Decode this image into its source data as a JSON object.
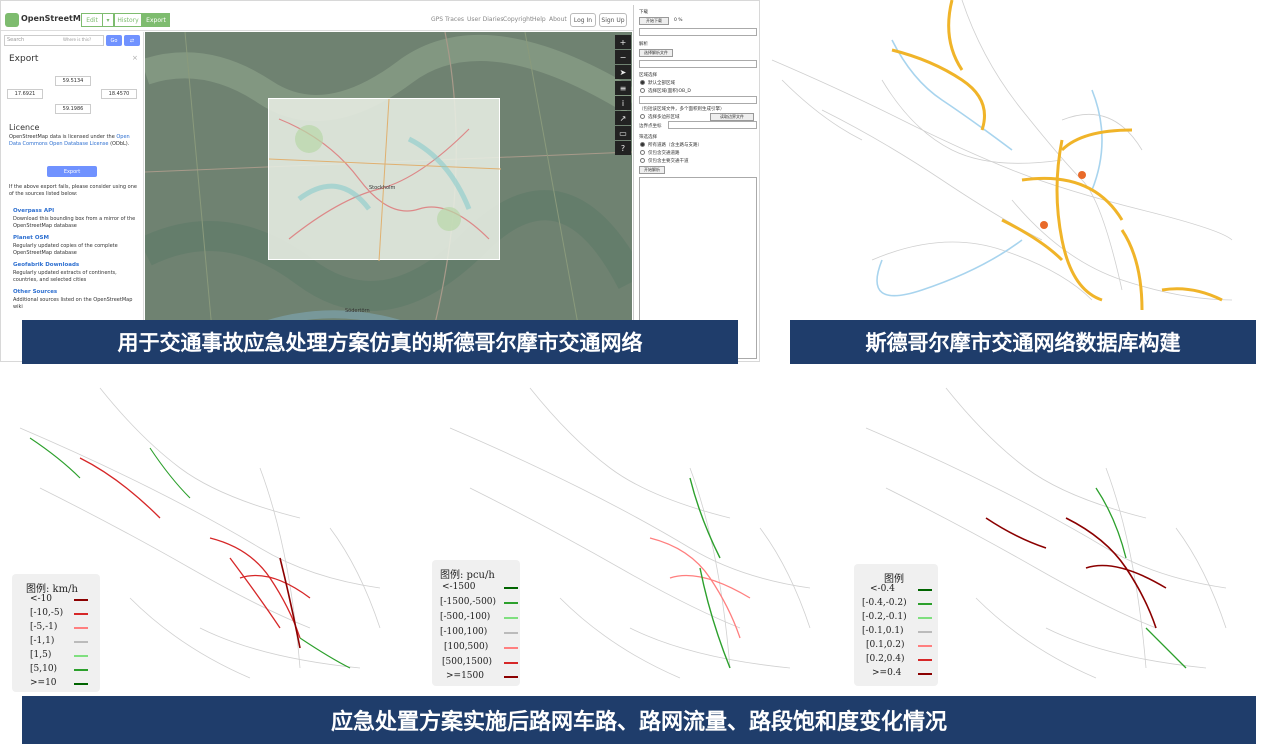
{
  "osm": {
    "brand": "OpenStreetMap",
    "header_buttons": [
      "Edit",
      "▾",
      "History",
      "Export"
    ],
    "nav_links": [
      "GPS Traces",
      "User Diaries",
      "Copyright",
      "Help",
      "About"
    ],
    "auth": {
      "login": "Log In",
      "signup": "Sign Up"
    },
    "search_placeholder": "Search",
    "where_am_i": "Where is this?",
    "go_label": "Go",
    "export_title": "Export",
    "coords": {
      "top": "59.5134",
      "left": "17.6921",
      "right": "18.4570",
      "bottom": "59.1986"
    },
    "licence_title": "Licence",
    "licence_text_1": "OpenStreetMap data is licensed under the",
    "licence_link": "Open Data Commons Open Database License",
    "licence_text_2": "(ODbL).",
    "export_button": "Export",
    "fallback_text": "If the above export fails, please consider using one of the sources listed below:",
    "sources": [
      {
        "name": "Overpass API",
        "desc": "Download this bounding box from a mirror of the OpenStreetMap database"
      },
      {
        "name": "Planet OSM",
        "desc": "Regularly updated copies of the complete OpenStreetMap database"
      },
      {
        "name": "Geofabrik Downloads",
        "desc": "Regularly updated extracts of continents, countries, and selected cities"
      },
      {
        "name": "Other Sources",
        "desc": "Additional sources listed on the OpenStreetMap wiki"
      }
    ],
    "map_labels": {
      "city": "Stockholm",
      "south": "Södertörn"
    }
  },
  "dialog": {
    "download_label": "下载",
    "start_download": "开始下载",
    "percent": "0 %",
    "parse_label": "解析",
    "choose_file": "选择解析文件",
    "area_label": "区域选择",
    "radio_1": "默认全部区域",
    "radio_2": "选择区域(面积)OB_D",
    "hint": "（包括该区域文件，多个面积则生成引擎）",
    "radio_3": "选择多边形区域",
    "open_boundary": "读取边界文件",
    "boundary_coords": "边界点坐标",
    "filter_label": "筛选选择",
    "filter_1": "所有道路（含主路与支路）",
    "filter_2": "仅包含交通道路",
    "filter_3": "仅包含主要交通干道",
    "start_parse": "开始解析"
  },
  "banners": {
    "top_left": "用于交通事故应急处理方案仿真的斯德哥尔摩市交通网络",
    "top_right": "斯德哥尔摩市交通网络数据库构建",
    "bottom": "应急处置方案实施后路网车路、路网流量、路段饱和度变化情况"
  },
  "legends": {
    "speed": {
      "title": "图例: km/h",
      "rows": [
        "<-10",
        "[-10,-5)",
        "[-5,-1)",
        "[-1,1)",
        "[1,5)",
        "[5,10)",
        ">=10"
      ],
      "colors": [
        "#8b0000",
        "#d62728",
        "#ff7f7f",
        "#bbbbbb",
        "#7fdf7f",
        "#2ca02c",
        "#006400"
      ]
    },
    "flow": {
      "title": "图例: pcu/h",
      "rows": [
        "<-1500",
        "[-1500,-500)",
        "[-500,-100)",
        "[-100,100)",
        "[100,500)",
        "[500,1500)",
        ">=1500"
      ],
      "colors": [
        "#006400",
        "#2ca02c",
        "#7fdf7f",
        "#bbbbbb",
        "#ff7f7f",
        "#d62728",
        "#8b0000"
      ]
    },
    "sat": {
      "title": "图例",
      "rows": [
        "<-0.4",
        "[-0.4,-0.2)",
        "[-0.2,-0.1)",
        "[-0.1,0.1)",
        "[0.1,0.2)",
        "[0.2,0.4)",
        ">=0.4"
      ],
      "colors": [
        "#006400",
        "#2ca02c",
        "#7fdf7f",
        "#bbbbbb",
        "#ff7f7f",
        "#d62728",
        "#8b0000"
      ]
    }
  },
  "colors": {
    "banner": "#1f3d6b",
    "osm_green": "#7ebc6f",
    "osm_blue": "#7092ff"
  }
}
